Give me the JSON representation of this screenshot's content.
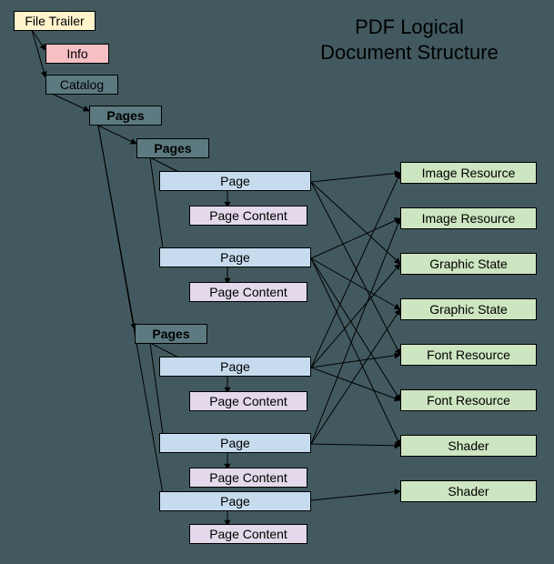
{
  "title_line1": "PDF Logical",
  "title_line2": "Document Structure",
  "nodes": {
    "file_trailer": "File Trailer",
    "info": "Info",
    "catalog": "Catalog",
    "pages_root": "Pages",
    "pages_a": "Pages",
    "page_a1": "Page",
    "pc_a1": "Page Content",
    "page_a2": "Page",
    "pc_a2": "Page Content",
    "pages_b": "Pages",
    "page_b1": "Page",
    "pc_b1": "Page Content",
    "page_b2": "Page",
    "pc_b2": "Page Content",
    "page_c": "Page",
    "pc_c": "Page Content",
    "res_img1": "Image Resource",
    "res_img2": "Image Resource",
    "res_gs1": "Graphic State",
    "res_gs2": "Graphic State",
    "res_font1": "Font Resource",
    "res_font2": "Font Resource",
    "res_sh1": "Shader",
    "res_sh2": "Shader"
  }
}
